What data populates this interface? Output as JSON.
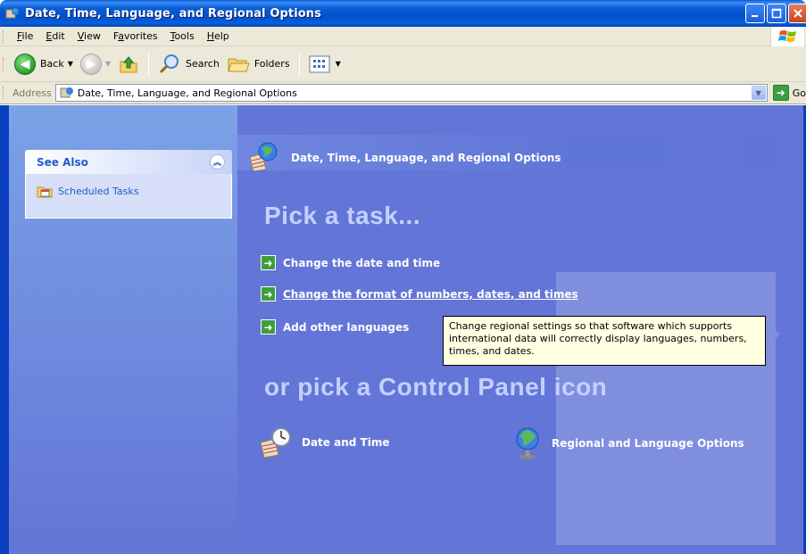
{
  "window": {
    "title": "Date, Time, Language, and Regional Options"
  },
  "menu": {
    "items": [
      "File",
      "Edit",
      "View",
      "Favorites",
      "Tools",
      "Help"
    ],
    "underlines": [
      "F",
      "E",
      "V",
      "a",
      "T",
      "H"
    ]
  },
  "toolbar": {
    "back_label": "Back",
    "search_label": "Search",
    "folders_label": "Folders"
  },
  "address": {
    "label": "Address",
    "value": "Date, Time, Language, and Regional Options",
    "go_label": "Go"
  },
  "see_also": {
    "title": "See Also",
    "items": [
      {
        "label": "Scheduled Tasks",
        "icon": "scheduled-tasks-icon"
      }
    ]
  },
  "main": {
    "header_title": "Date, Time, Language, and Regional Options",
    "pick_task": "Pick a task...",
    "tasks": [
      {
        "label": "Change the date and time"
      },
      {
        "label": "Change the format of numbers, dates, and times"
      },
      {
        "label": "Add other languages"
      }
    ],
    "or_pick": "or pick a Control Panel icon",
    "icons": [
      {
        "label": "Date and Time",
        "icon": "date-time-icon"
      },
      {
        "label": "Regional and Language Options",
        "icon": "globe-icon"
      }
    ]
  },
  "tooltip": {
    "text": "Change regional settings so that software which supports international data will correctly display languages, numbers, times, and dates."
  },
  "colors": {
    "titlebar": "#0a5fd8",
    "main_background": "#6375d6",
    "link_blue": "#215dc6",
    "tooltip_bg": "#ffffe1"
  }
}
